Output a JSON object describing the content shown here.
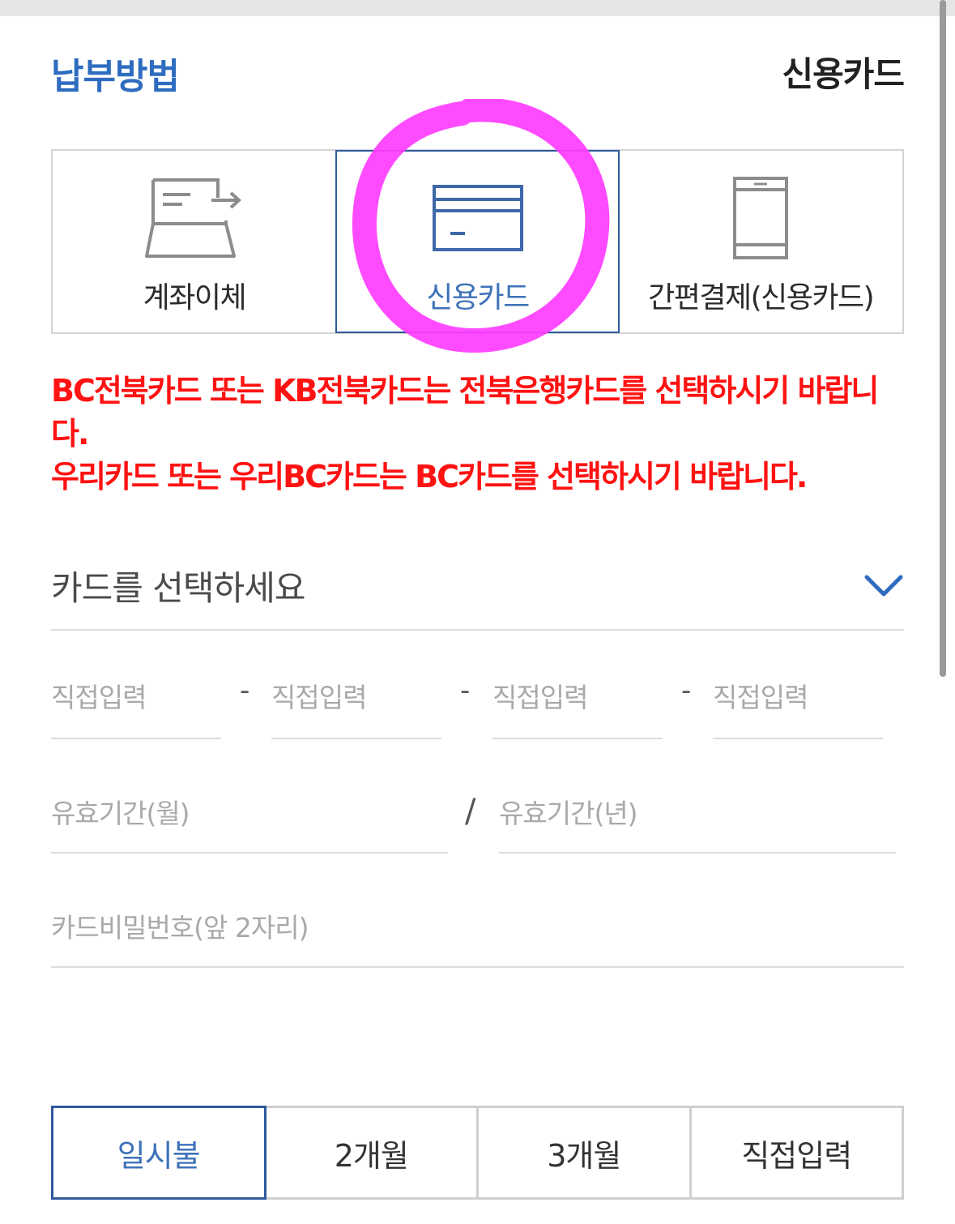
{
  "payment": {
    "section_title": "납부방법",
    "selected_method_label": "신용카드",
    "methods": [
      {
        "label": "계좌이체",
        "icon": "bank-transfer-icon",
        "selected": false
      },
      {
        "label": "신용카드",
        "icon": "credit-card-icon",
        "selected": true
      },
      {
        "label": "간편결제(신용카드)",
        "icon": "mobile-phone-icon",
        "selected": false
      }
    ]
  },
  "notice": {
    "line1": "BC전북카드 또는 KB전북카드는 전북은행카드를 선택하시기 바랍니다.",
    "line2": "우리카드 또는 우리BC카드는 BC카드를 선택하시기 바랍니다."
  },
  "card_select": {
    "placeholder": "카드를 선택하세요",
    "icon": "chevron-down-icon"
  },
  "card_number": {
    "placeholders": [
      "직접입력",
      "직접입력",
      "직접입력",
      "직접입력"
    ],
    "separator": "-"
  },
  "expiry": {
    "month_placeholder": "유효기간(월)",
    "year_placeholder": "유효기간(년)",
    "separator": "/"
  },
  "card_password": {
    "placeholder": "카드비밀번호(앞 2자리)"
  },
  "installment": {
    "options": [
      "일시불",
      "2개월",
      "3개월",
      "직접입력"
    ],
    "selected_index": 0
  },
  "colors": {
    "accent": "#2e6cc0",
    "notice": "#ff1212",
    "annotation": "#ff3cff"
  }
}
